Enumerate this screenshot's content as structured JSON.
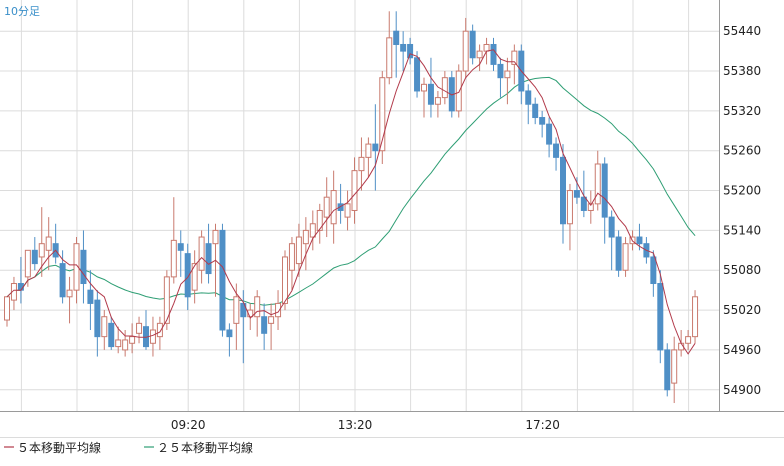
{
  "colors": {
    "background": "#ffffff",
    "grid": "#dcdcdc",
    "frame": "#9a9a9a",
    "bull_candle": "#c97a6e",
    "bear_candle": "#4f8fc6",
    "ma5": "#b23a4a",
    "ma25": "#2e9e74",
    "timeframe_text": "#3a8fc9"
  },
  "chart_data": {
    "type": "candlestick",
    "timeframe_label": "10分足",
    "x_tick_labels": [
      "09:20",
      "13:20",
      "17:20"
    ],
    "y_ticks": [
      55440,
      55380,
      55320,
      55260,
      55200,
      55140,
      55080,
      55020,
      54960,
      54900
    ],
    "ylim": [
      54868,
      55487
    ],
    "grid": true,
    "legend_position": "bottom-left",
    "legend": [
      {
        "key": "ma5",
        "label": "５本移動平均線"
      },
      {
        "key": "ma25",
        "label": "２５本移動平均線"
      }
    ],
    "candles": [
      [
        55005,
        55040,
        54995,
        55040
      ],
      [
        55035,
        55070,
        55020,
        55060
      ],
      [
        55060,
        55100,
        55030,
        55050
      ],
      [
        55070,
        55110,
        55055,
        55110
      ],
      [
        55110,
        55130,
        55080,
        55090
      ],
      [
        55100,
        55175,
        55070,
        55120
      ],
      [
        55110,
        55160,
        55080,
        55130
      ],
      [
        55120,
        55150,
        55090,
        55100
      ],
      [
        55090,
        55110,
        55030,
        55040
      ],
      [
        55040,
        55070,
        55000,
        55050
      ],
      [
        55050,
        55130,
        55030,
        55120
      ],
      [
        55110,
        55140,
        55030,
        55060
      ],
      [
        55050,
        55080,
        54990,
        55030
      ],
      [
        55035,
        55050,
        54950,
        54980
      ],
      [
        54980,
        55020,
        54960,
        55010
      ],
      [
        55000,
        55010,
        54960,
        54965
      ],
      [
        54965,
        54995,
        54955,
        54975
      ],
      [
        54960,
        54990,
        54950,
        54975
      ],
      [
        54970,
        55000,
        54955,
        54980
      ],
      [
        54985,
        55010,
        54970,
        55000
      ],
      [
        54995,
        55020,
        54960,
        54965
      ],
      [
        54970,
        55010,
        54950,
        54990
      ],
      [
        54980,
        55010,
        54960,
        55000
      ],
      [
        55000,
        55080,
        54990,
        55070
      ],
      [
        55070,
        55190,
        55060,
        55125
      ],
      [
        55120,
        55140,
        55070,
        55110
      ],
      [
        55105,
        55120,
        55020,
        55040
      ],
      [
        55050,
        55110,
        55030,
        55090
      ],
      [
        55080,
        55140,
        55060,
        55130
      ],
      [
        55120,
        55150,
        55060,
        55075
      ],
      [
        55120,
        55150,
        55040,
        55140
      ],
      [
        55140,
        55150,
        54980,
        54990
      ],
      [
        54990,
        55000,
        54950,
        54980
      ],
      [
        55000,
        55060,
        54960,
        55040
      ],
      [
        55030,
        55050,
        54940,
        55010
      ],
      [
        55010,
        55030,
        54990,
        55020
      ],
      [
        55010,
        55050,
        54980,
        55040
      ],
      [
        55010,
        55030,
        54960,
        54985
      ],
      [
        55000,
        55030,
        54960,
        55010
      ],
      [
        55010,
        55050,
        54990,
        55030
      ],
      [
        55030,
        55110,
        55020,
        55100
      ],
      [
        55080,
        55130,
        55050,
        55120
      ],
      [
        55090,
        55150,
        55070,
        55130
      ],
      [
        55120,
        55160,
        55080,
        55140
      ],
      [
        55130,
        55170,
        55110,
        55150
      ],
      [
        55140,
        55180,
        55120,
        55170
      ],
      [
        55160,
        55220,
        55130,
        55190
      ],
      [
        55150,
        55230,
        55120,
        55200
      ],
      [
        55180,
        55210,
        55150,
        55170
      ],
      [
        55160,
        55200,
        55140,
        55180
      ],
      [
        55170,
        55250,
        55150,
        55230
      ],
      [
        55230,
        55280,
        55200,
        55250
      ],
      [
        55250,
        55280,
        55220,
        55270
      ],
      [
        55270,
        55330,
        55200,
        55260
      ],
      [
        55260,
        55380,
        55240,
        55370
      ],
      [
        55370,
        55470,
        55360,
        55430
      ],
      [
        55440,
        55470,
        55370,
        55420
      ],
      [
        55420,
        55440,
        55380,
        55410
      ],
      [
        55420,
        55430,
        55390,
        55400
      ],
      [
        55400,
        55410,
        55340,
        55350
      ],
      [
        55350,
        55370,
        55310,
        55360
      ],
      [
        55360,
        55400,
        55310,
        55330
      ],
      [
        55330,
        55350,
        55310,
        55340
      ],
      [
        55340,
        55380,
        55330,
        55370
      ],
      [
        55370,
        55380,
        55310,
        55320
      ],
      [
        55320,
        55390,
        55310,
        55380
      ],
      [
        55380,
        55460,
        55370,
        55440
      ],
      [
        55440,
        55450,
        55390,
        55400
      ],
      [
        55400,
        55420,
        55380,
        55410
      ],
      [
        55410,
        55430,
        55390,
        55420
      ],
      [
        55420,
        55430,
        55380,
        55390
      ],
      [
        55390,
        55400,
        55340,
        55370
      ],
      [
        55370,
        55400,
        55330,
        55380
      ],
      [
        55390,
        55420,
        55360,
        55410
      ],
      [
        55410,
        55420,
        55330,
        55350
      ],
      [
        55350,
        55360,
        55300,
        55330
      ],
      [
        55330,
        55340,
        55300,
        55310
      ],
      [
        55310,
        55320,
        55280,
        55300
      ],
      [
        55300,
        55310,
        55250,
        55270
      ],
      [
        55270,
        55280,
        55230,
        55250
      ],
      [
        55250,
        55270,
        55120,
        55150
      ],
      [
        55150,
        55210,
        55110,
        55200
      ],
      [
        55200,
        55220,
        55180,
        55190
      ],
      [
        55190,
        55230,
        55160,
        55170
      ],
      [
        55170,
        55200,
        55150,
        55180
      ],
      [
        55180,
        55260,
        55170,
        55240
      ],
      [
        55240,
        55250,
        55120,
        55160
      ],
      [
        55160,
        55170,
        55080,
        55130
      ],
      [
        55130,
        55140,
        55070,
        55080
      ],
      [
        55080,
        55130,
        55070,
        55120
      ],
      [
        55120,
        55140,
        55110,
        55130
      ],
      [
        55130,
        55150,
        55110,
        55120
      ],
      [
        55120,
        55130,
        55090,
        55100
      ],
      [
        55100,
        55110,
        55040,
        55060
      ],
      [
        55060,
        55080,
        54940,
        54960
      ],
      [
        54960,
        54970,
        54890,
        54900
      ],
      [
        54910,
        54980,
        54880,
        54960
      ],
      [
        54960,
        54990,
        54950,
        54970
      ],
      [
        54970,
        54990,
        54960,
        54980
      ],
      [
        54980,
        55050,
        54970,
        55040
      ]
    ]
  }
}
